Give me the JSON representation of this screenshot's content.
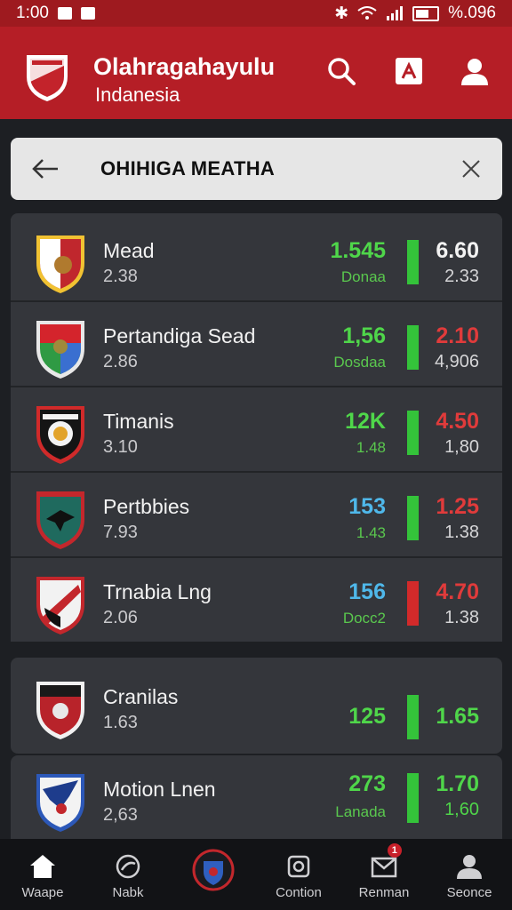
{
  "status_bar": {
    "time": "1:00",
    "right_text": "%.096"
  },
  "header": {
    "title": "Olahragahayulu",
    "subtitle": "Indanesia",
    "accent": "#b51e26"
  },
  "search": {
    "query": "OHIHIGA MEATHA"
  },
  "teams_group1": [
    {
      "name": "Mead",
      "sub": "2.38",
      "value": "1.545",
      "value_color": "#4fd64a",
      "value_sub": "Donaa",
      "value_sub_color": "#5ac84e",
      "bar_color": "#34c33a",
      "odds": "6.60",
      "odds_sub": "2.33",
      "odds_color": "#f2f2f2"
    },
    {
      "name": "Pertandiga Sead",
      "sub": "2.86",
      "value": "1,56",
      "value_color": "#4fd64a",
      "value_sub": "Dosdaa",
      "value_sub_color": "#5ac84e",
      "bar_color": "#34c33a",
      "odds": "2.10",
      "odds_sub": "4,906",
      "odds_color": "#e03b3b"
    },
    {
      "name": "Timanis",
      "sub": "3.10",
      "value": "12K",
      "value_color": "#4fd64a",
      "value_sub": "1.48",
      "value_sub_color": "#5ac84e",
      "bar_color": "#34c33a",
      "odds": "4.50",
      "odds_sub": "1,80",
      "odds_color": "#e03b3b"
    },
    {
      "name": "Pertbbies",
      "sub": "7.93",
      "value": "153",
      "value_color": "#4fb8ea",
      "value_sub": "1.43",
      "value_sub_color": "#5ac84e",
      "bar_color": "#34c33a",
      "odds": "1.25",
      "odds_sub": "1.38",
      "odds_color": "#e03b3b"
    },
    {
      "name": "Trnabia Lng",
      "sub": "2.06",
      "value": "156",
      "value_color": "#4fb8ea",
      "value_sub": "Docc2",
      "value_sub_color": "#5ac84e",
      "bar_color": "#d22a2a",
      "odds": "4.70",
      "odds_sub": "1.38",
      "odds_color": "#e03b3b"
    }
  ],
  "teams_group2": [
    {
      "name": "Cranilas",
      "sub": "1.63",
      "value": "125",
      "value_color": "#4fd64a",
      "bar_color": "#34c33a",
      "odds": "1.65",
      "odds_color": "#4fd64a"
    },
    {
      "name": "Motion Lnen",
      "sub": "2,63",
      "value": "273",
      "value_color": "#4fd64a",
      "value_sub": "Lanada",
      "value_sub_color": "#5ac84e",
      "bar_color": "#34c33a",
      "odds": "1.70",
      "odds_sub": "1,60",
      "odds_color": "#4fd64a",
      "odds_sub_color": "#4fd64a"
    }
  ],
  "nav": [
    {
      "label": "Waape",
      "icon": "home-icon"
    },
    {
      "label": "Nabk",
      "icon": "ball-icon"
    },
    {
      "label": "",
      "icon": "club-crest-icon"
    },
    {
      "label": "Contion",
      "icon": "camera-icon"
    },
    {
      "label": "Renman",
      "icon": "mail-icon",
      "badge": "1"
    },
    {
      "label": "Seonce",
      "icon": "profile-icon"
    }
  ]
}
